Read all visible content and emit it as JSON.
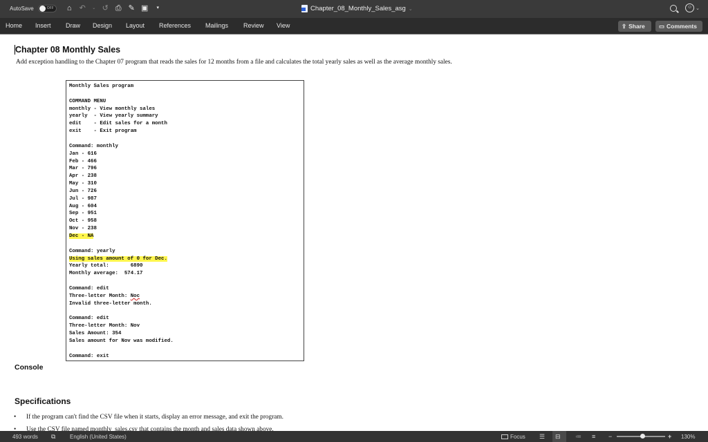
{
  "titlebar": {
    "autosave_label": "AutoSave",
    "autosave_state": "OFF",
    "doc_title": "Chapter_08_Monthly_Sales_asg",
    "icons": [
      "home-icon",
      "undo-icon",
      "redo-icon",
      "print-icon",
      "edit-doc-icon",
      "save-icon",
      "customize-toolbar-icon",
      "search-icon",
      "feedback-smiley-icon"
    ]
  },
  "ribbon": {
    "tabs": [
      "Home",
      "Insert",
      "Draw",
      "Design",
      "Layout",
      "References",
      "Mailings",
      "Review",
      "View"
    ],
    "share_label": "Share",
    "comments_label": "Comments"
  },
  "document": {
    "heading": "Chapter 08 Monthly Sales",
    "intro": "Add exception handling to the Chapter 07 program that reads the sales for 12 months from a file and calculates the total yearly sales as well as the average monthly sales.",
    "console_lines": [
      {
        "text": "Monthly Sales program",
        "highlight": false
      },
      {
        "text": "",
        "highlight": false
      },
      {
        "text": "COMMAND MENU",
        "highlight": false
      },
      {
        "text": "monthly - View monthly sales",
        "highlight": false
      },
      {
        "text": "yearly  - View yearly summary",
        "highlight": false
      },
      {
        "text": "edit    - Edit sales for a month",
        "highlight": false
      },
      {
        "text": "exit    - Exit program",
        "highlight": false
      },
      {
        "text": "",
        "highlight": false
      },
      {
        "text": "Command: monthly",
        "highlight": false
      },
      {
        "text": "Jan - 616",
        "highlight": false
      },
      {
        "text": "Feb - 466",
        "highlight": false
      },
      {
        "text": "Mar - 796",
        "highlight": false
      },
      {
        "text": "Apr - 238",
        "highlight": false
      },
      {
        "text": "May - 310",
        "highlight": false
      },
      {
        "text": "Jun - 726",
        "highlight": false
      },
      {
        "text": "Jul - 987",
        "highlight": false
      },
      {
        "text": "Aug - 604",
        "highlight": false
      },
      {
        "text": "Sep - 951",
        "highlight": false
      },
      {
        "text": "Oct - 958",
        "highlight": false
      },
      {
        "text": "Nov - 238",
        "highlight": false
      },
      {
        "text": "Dec - NA",
        "highlight": true
      },
      {
        "text": "",
        "highlight": false
      },
      {
        "text": "Command: yearly",
        "highlight": false
      },
      {
        "text": "Using sales amount of 0 for Dec.",
        "highlight": true
      },
      {
        "text": "Yearly total:       6890",
        "highlight": false
      },
      {
        "text": "Monthly average:  574.17",
        "highlight": false
      },
      {
        "text": "",
        "highlight": false
      },
      {
        "text": "Command: edit",
        "highlight": false
      },
      {
        "text": "Three-letter Month: ",
        "highlight": false,
        "squiggle": "Noc"
      },
      {
        "text": "Invalid three-letter month.",
        "highlight": false
      },
      {
        "text": "",
        "highlight": false
      },
      {
        "text": "Command: edit",
        "highlight": false
      },
      {
        "text": "Three-letter Month: Nov",
        "highlight": false
      },
      {
        "text": "Sales Amount: 354",
        "highlight": false
      },
      {
        "text": "Sales amount for Nov was modified.",
        "highlight": false
      },
      {
        "text": "",
        "highlight": false
      },
      {
        "text": "Command: exit",
        "highlight": false
      }
    ],
    "console_label": "Console",
    "specs_heading": "Specifications",
    "bullets": [
      "If the program can't find the CSV file when it starts, display an error message, and exit the program.",
      "Use the CSV file named monthly_sales.csv that contains the month and sales data shown above."
    ]
  },
  "statusbar": {
    "word_count": "493 words",
    "language": "English (United States)",
    "focus_label": "Focus",
    "zoom_level": "130%",
    "zoom_percent": 130
  }
}
